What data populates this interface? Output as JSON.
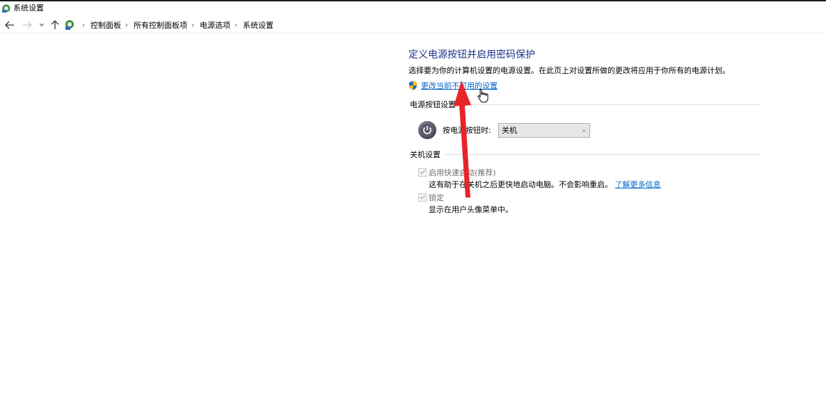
{
  "window": {
    "title": "系统设置"
  },
  "navigation": {
    "back_icon": "arrow-left-icon",
    "forward_icon": "arrow-right-icon",
    "recent_icon": "chevron-down-icon",
    "up_icon": "arrow-up-icon",
    "breadcrumbs": [
      "控制面板",
      "所有控制面板项",
      "电源选项",
      "系统设置"
    ]
  },
  "page": {
    "heading": "定义电源按钮并启用密码保护",
    "description": "选择要为你的计算机设置的电源设置。在此页上对设置所做的更改将应用于你所有的电源计划。",
    "change_settings_link": "更改当前不可用的设置"
  },
  "power_button_section": {
    "title": "电源按钮设置",
    "label": "按电源按钮时:",
    "selected_value": "关机"
  },
  "shutdown_section": {
    "title": "关机设置",
    "fast_startup": {
      "label": "启用快速启动(推荐)",
      "checked": true,
      "description": "这有助于在关机之后更快地启动电脑。不会影响重启。",
      "learn_more_link": "了解更多信息"
    },
    "lock": {
      "label": "锁定",
      "checked": true,
      "description": "显示在用户头像菜单中。"
    }
  },
  "colors": {
    "heading": "#1e3287",
    "link": "#0066cc",
    "annotation_arrow": "#e8242b"
  }
}
